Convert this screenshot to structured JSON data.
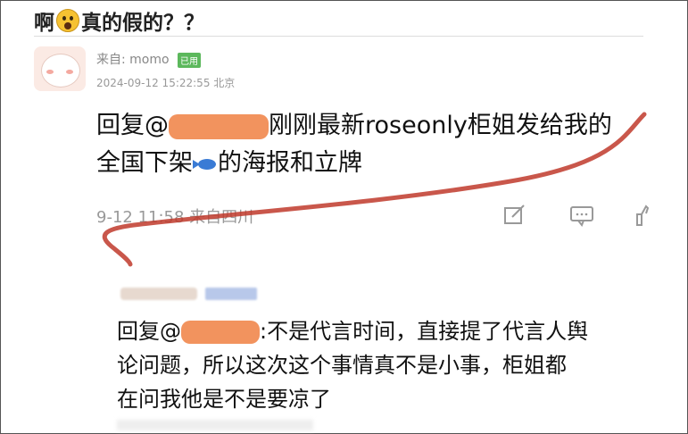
{
  "header": {
    "title_before": "啊",
    "emoji": "astonished-face",
    "title_after": "真的假的？？"
  },
  "post": {
    "from": "来自: momo",
    "badge": "已用",
    "timestamp": "2024-09-12 15:22:55 北京",
    "reply_prefix": "回复@",
    "text_line1_rest": "刚刚最新roseonly柜姐发给我的",
    "text_line2_a": "全国下架",
    "text_line2_icon": "fish-emoji",
    "text_line2_b": "的海报和立牌",
    "meta": "9-12 11:58  来自四川",
    "actions": [
      "edit-icon",
      "comment-icon",
      "like-icon"
    ]
  },
  "reply": {
    "reply_prefix": "回复@",
    "line1_rest": ":不是代言时间，直接提了代言人舆",
    "line2": "论问题，所以这次这个事情真不是小事，柜姐都",
    "line3": "在问我他是不是要凉了"
  },
  "colors": {
    "annotation_stroke": "#c0392b",
    "redaction": "#f2935e",
    "badge": "#5cb85c"
  }
}
